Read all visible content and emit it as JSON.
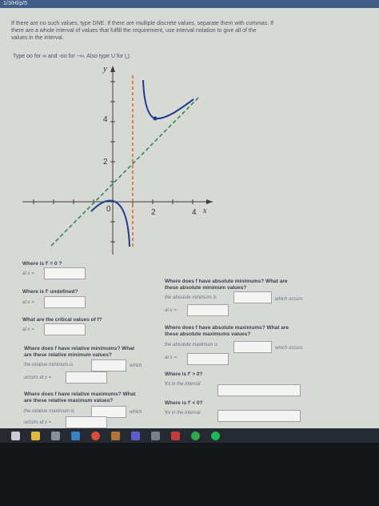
{
  "topbar": {
    "tab": "1/3/Hl/p/5"
  },
  "instructions": {
    "line1": "If there are no such values, type DNE. If there are multiple discrete values, separate them with commas. If",
    "line2": "there are a whole interval of values that fulfill the requirement, use interval notation to give all of the",
    "line3": "values in the interval.",
    "line4": "Type oo for ∞ and -oo for −∞. Also type U for ⋃."
  },
  "graph": {
    "y_label": "y",
    "x_label": "x",
    "tick_labels": {
      "y4": "4",
      "y2": "2",
      "origin": "0",
      "x2": "2",
      "x4": "4"
    }
  },
  "left_questions": {
    "q1_label": "Where is f′ = 0 ?",
    "q1_at": "at x =",
    "q2_label": "Where is f′ undefined?",
    "q2_at": "at x =",
    "q3_label": "What are the critical values of f?",
    "q3_at": "at x =",
    "q4_label1": "Where does f have relative minimums? What",
    "q4_label2": "are these relative minimum values?",
    "q4_sub": "the relative minimum is",
    "q4_which": "which",
    "q4_occurs": "occurs at x =",
    "q5_label1": "Where does f have relative maximums? What",
    "q5_label2": "are these relative maximum values?",
    "q5_sub": "the relative maximum is",
    "q5_which": "which",
    "q5_occurs": "occurs at x ="
  },
  "right_questions": {
    "q6_label1": "Where does f have absolute minimums? What are",
    "q6_label2": "these absolute minimum values?",
    "q6_sub": "the absolute minimum is",
    "q6_which": "which occurs",
    "q6_at": "at x =",
    "q7_label1": "Where does f have absolute maximums? What are",
    "q7_label2": "these absolute maximums values?",
    "q7_sub": "the absolute maximum is",
    "q7_which": "which occurs",
    "q7_at": "at x =",
    "q8_label": "Where is f′ > 0?",
    "q8_sub": "∀x in the interval",
    "q9_label": "Where is f′ < 0?",
    "q9_sub": "∀x in the interval"
  },
  "colors": {
    "graph_curve": "#1f3a8f",
    "asymptote": "#e06a2a",
    "dashed_line": "#2e8b57",
    "topbar": "#3f5d86"
  },
  "taskbar_icons": [
    "windows-start-icon",
    "file-explorer-icon",
    "store-icon",
    "mail-icon",
    "chrome-icon",
    "app-icon",
    "teams-icon",
    "app2-icon",
    "media-icon",
    "green-app-icon",
    "spotify-icon"
  ]
}
